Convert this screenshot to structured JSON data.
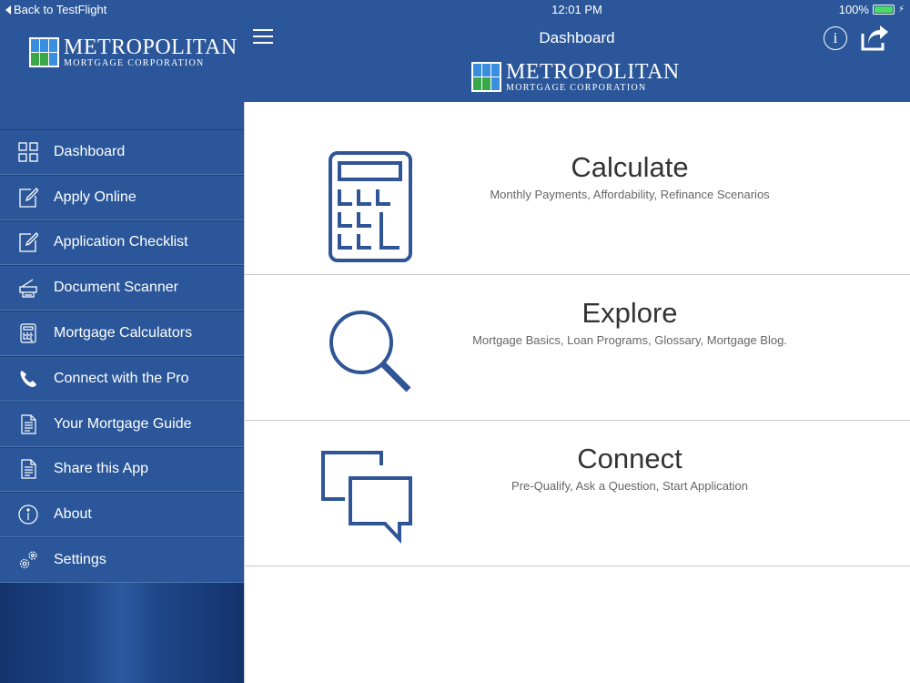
{
  "status": {
    "back": "Back to TestFlight",
    "time": "12:01 PM",
    "battery": "100%"
  },
  "brand": {
    "name": "METROPOLITAN",
    "sub": "MORTGAGE CORPORATION"
  },
  "header": {
    "title": "Dashboard",
    "info_label": "i"
  },
  "sidebar": {
    "items": [
      {
        "label": "Dashboard",
        "icon": "grid-icon"
      },
      {
        "label": "Apply Online",
        "icon": "edit-icon"
      },
      {
        "label": "Application Checklist",
        "icon": "edit-icon"
      },
      {
        "label": "Document Scanner",
        "icon": "scanner-icon"
      },
      {
        "label": "Mortgage Calculators",
        "icon": "calculator-icon"
      },
      {
        "label": "Connect with the Pro",
        "icon": "phone-icon"
      },
      {
        "label": "Your Mortgage Guide",
        "icon": "document-icon"
      },
      {
        "label": "Share this App",
        "icon": "document-icon"
      },
      {
        "label": "About",
        "icon": "info-icon"
      },
      {
        "label": "Settings",
        "icon": "gear-icon"
      }
    ]
  },
  "cards": [
    {
      "title": "Calculate",
      "sub": "Monthly Payments, Affordability, Refinance Scenarios",
      "icon": "calculator-icon"
    },
    {
      "title": "Explore",
      "sub": "Mortgage Basics, Loan Programs, Glossary, Mortgage Blog.",
      "icon": "magnifier-icon"
    },
    {
      "title": "Connect",
      "sub": "Pre-Qualify, Ask a Question, Start Application",
      "icon": "chat-icon"
    }
  ],
  "colors": {
    "primary": "#2b579a",
    "icon_blue": "#2f5597",
    "logo_blue": "#3a8ee0",
    "logo_green": "#3aa84a"
  }
}
